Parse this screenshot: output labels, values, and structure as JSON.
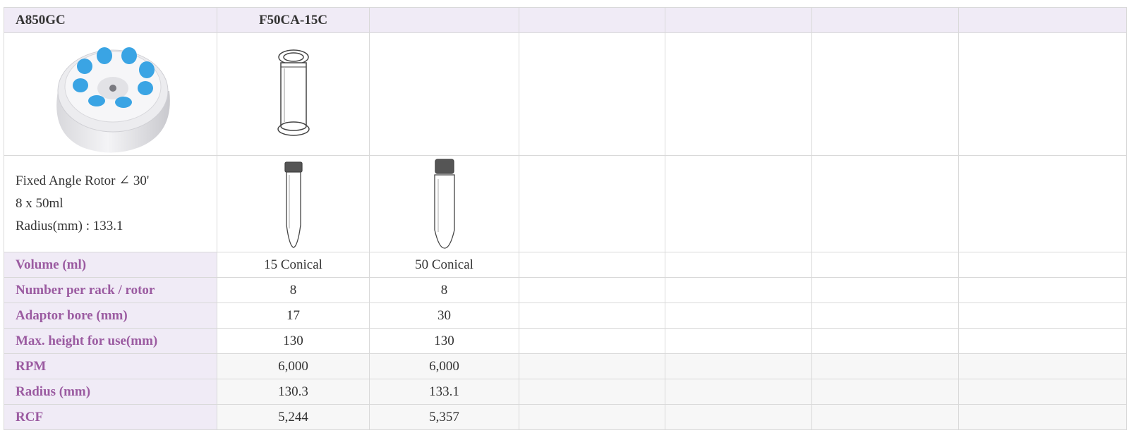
{
  "header": {
    "col1": "A850GC",
    "col2": "F50CA-15C"
  },
  "rotor_description": {
    "line1": "Fixed Angle Rotor ∠ 30'",
    "line2": "8 x 50ml",
    "line3": "Radius(mm) : 133.1"
  },
  "images": {
    "rotor": "rotor-image",
    "adaptor": "adaptor-sleeve-image",
    "tube_15": "15ml-conical-tube-image",
    "tube_50": "50ml-conical-tube-image"
  },
  "rows": [
    {
      "label": "Volume (ml)",
      "v1": "15 Conical",
      "v2": "50 Conical"
    },
    {
      "label": "Number per rack / rotor",
      "v1": "8",
      "v2": "8"
    },
    {
      "label": "Adaptor bore (mm)",
      "v1": "17",
      "v2": "30"
    },
    {
      "label": "Max. height for use(mm)",
      "v1": "130",
      "v2": "130"
    },
    {
      "label": "RPM",
      "v1": "6,000",
      "v2": "6,000"
    },
    {
      "label": "Radius (mm)",
      "v1": "130.3",
      "v2": "133.1"
    },
    {
      "label": "RCF",
      "v1": "5,244",
      "v2": "5,357"
    }
  ],
  "colors": {
    "header_bg": "#f0ebf6",
    "label_text": "#9b5ba1",
    "rotor_cap": "#3aa4e4"
  }
}
